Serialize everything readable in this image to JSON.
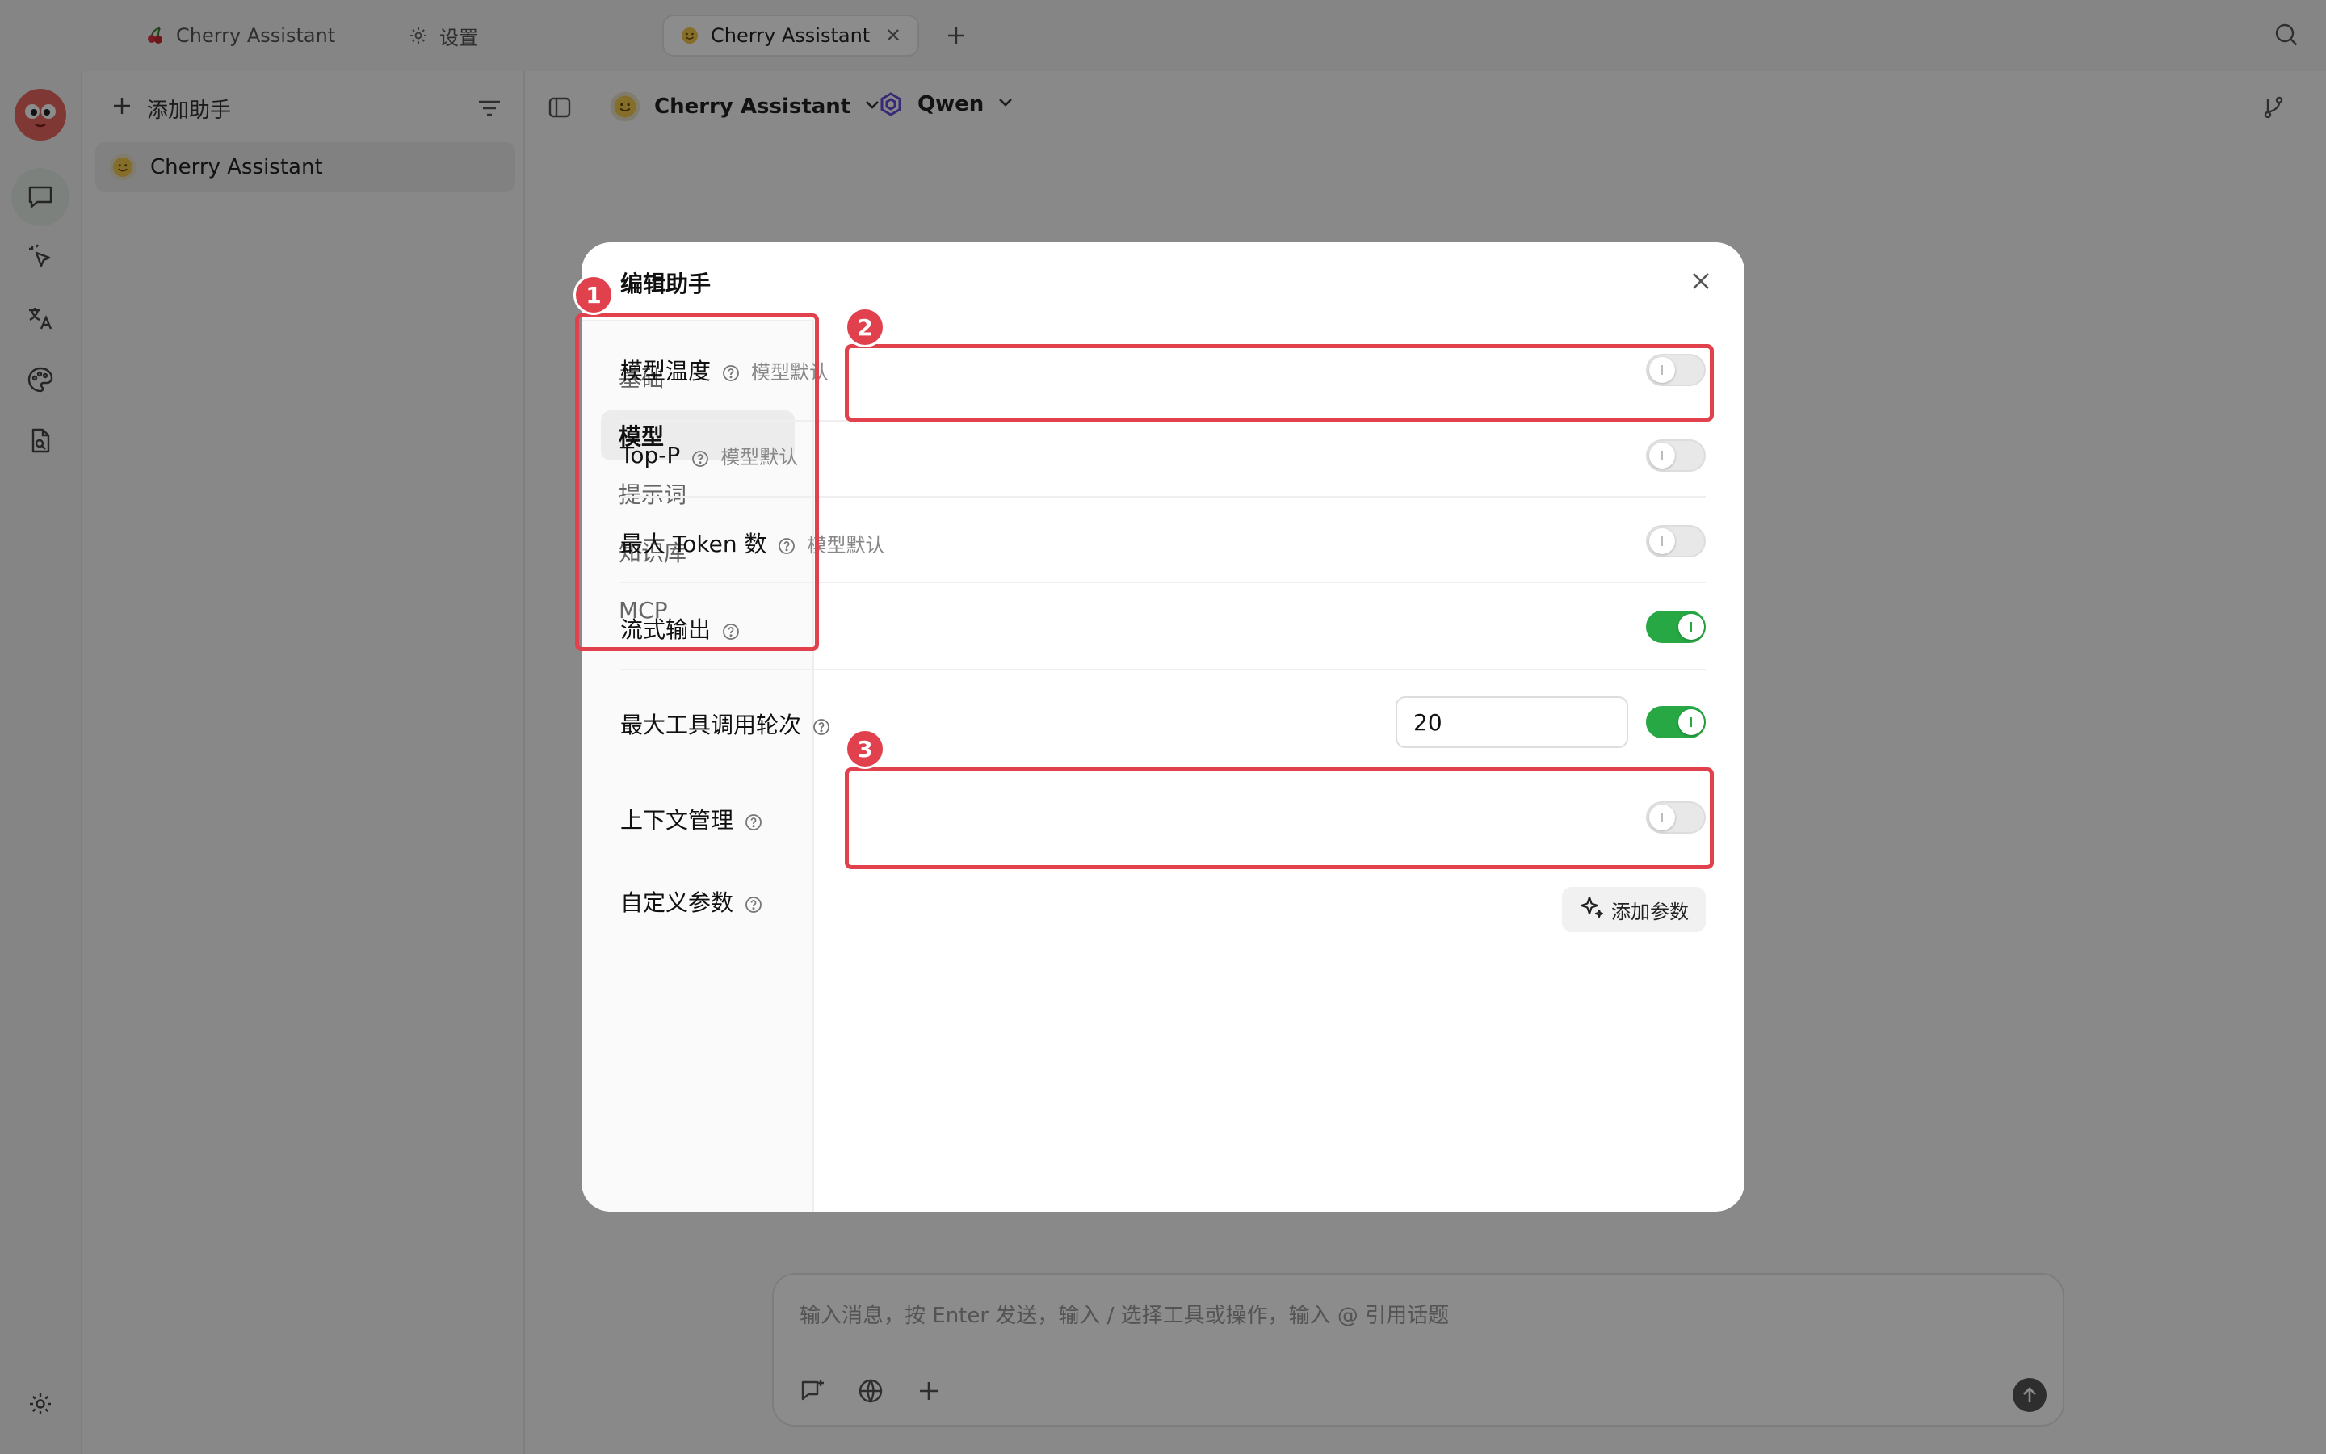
{
  "titlebar": {
    "tabs": [
      {
        "label": "Cherry Assistant",
        "icon": "cherry-icon"
      },
      {
        "label": "设置",
        "icon": "gear-icon"
      },
      {
        "label": "Cherry Assistant",
        "icon": "smiley-icon",
        "active": true
      }
    ]
  },
  "list": {
    "add_label": "添加助手",
    "items": [
      {
        "label": "Cherry Assistant"
      }
    ]
  },
  "header": {
    "assistant": "Cherry Assistant",
    "model": "Qwen"
  },
  "modal": {
    "title": "编辑助手",
    "menu": [
      {
        "label": "基础"
      },
      {
        "label": "模型",
        "active": true
      },
      {
        "label": "提示词"
      },
      {
        "label": "知识库"
      },
      {
        "label": "MCP"
      }
    ],
    "rows": [
      {
        "label": "模型温度",
        "hint": "模型默认",
        "toggle": false
      },
      {
        "label": "Top-P",
        "hint": "模型默认",
        "toggle": false
      },
      {
        "label": "最大 Token 数",
        "hint": "模型默认",
        "toggle": false
      },
      {
        "label": "流式输出",
        "hint": "",
        "toggle": true
      },
      {
        "label": "最大工具调用轮次",
        "hint": "",
        "toggle": true,
        "value": "20"
      },
      {
        "label": "上下文管理",
        "hint": "",
        "toggle": false
      },
      {
        "label": "自定义参数",
        "hint": "",
        "button": "添加参数"
      }
    ],
    "badges": [
      "1",
      "2",
      "3"
    ]
  },
  "composer": {
    "placeholder": "输入消息，按 Enter 发送，输入 / 选择工具或操作，输入 @ 引用话题"
  },
  "colors": {
    "accent_green": "#27a844",
    "highlight_red": "#e0414d"
  }
}
